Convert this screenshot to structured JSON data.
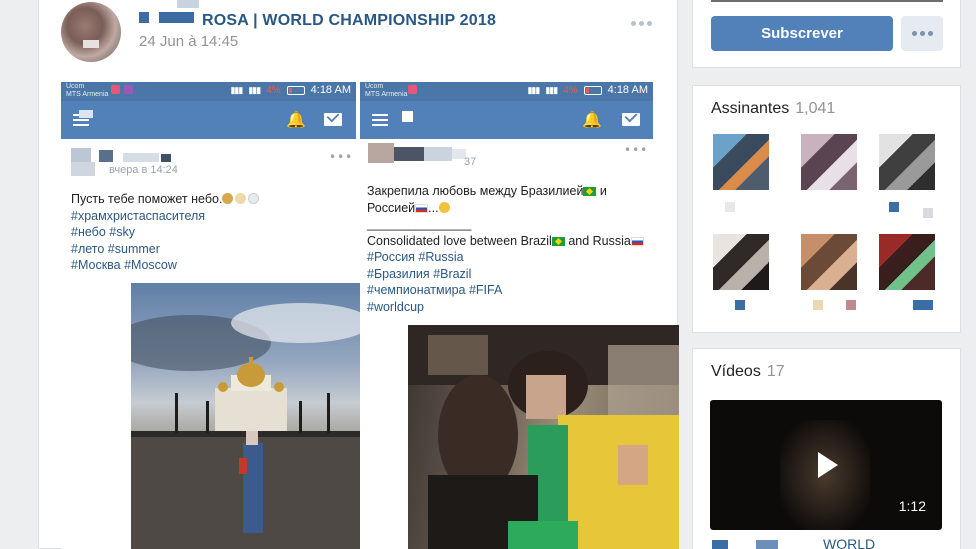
{
  "post": {
    "group_name": "ROSA | WORLD CHAMPIONSHIP 2018",
    "date": "24 Jun à 14:45"
  },
  "screenshot_left": {
    "carrier": "Ucom\nMTS Armenia",
    "battery_pct": "4%",
    "time": "4:18 AM",
    "meta": "вчера в 14:24",
    "caption_line1": "Пусть тебе поможет небо.",
    "tags": [
      "#храмхристаспасителя",
      "#небо #sky",
      "#лето #summer",
      "#Москва #Moscow"
    ]
  },
  "screenshot_right": {
    "carrier": "Ucom\nMTS Armenia",
    "battery_pct": "4%",
    "time": "4:18 AM",
    "meta": "37",
    "line1": "Закрепила любовь между Бразилией",
    "line1_end": " и",
    "line2": "Россией",
    "line2_end": "...",
    "divider": "_______________",
    "line3": "Consolidated love between Brazil",
    "line3_mid": " and Russia",
    "tags": [
      "#Россия #Russia",
      "#Бразилия #Brazil",
      "#чемпионатмира #FIFA",
      "#worldcup"
    ]
  },
  "sidebar": {
    "subscribe_label": "Subscrever",
    "members_title": "Assinantes",
    "members_count": "1,041",
    "videos_title": "Vídeos",
    "videos_count": "17",
    "video_duration": "1:12",
    "video_title_partial": "WORLD"
  },
  "colors": {
    "accent": "#5181b8",
    "link": "#2a5885",
    "muted": "#939393"
  }
}
